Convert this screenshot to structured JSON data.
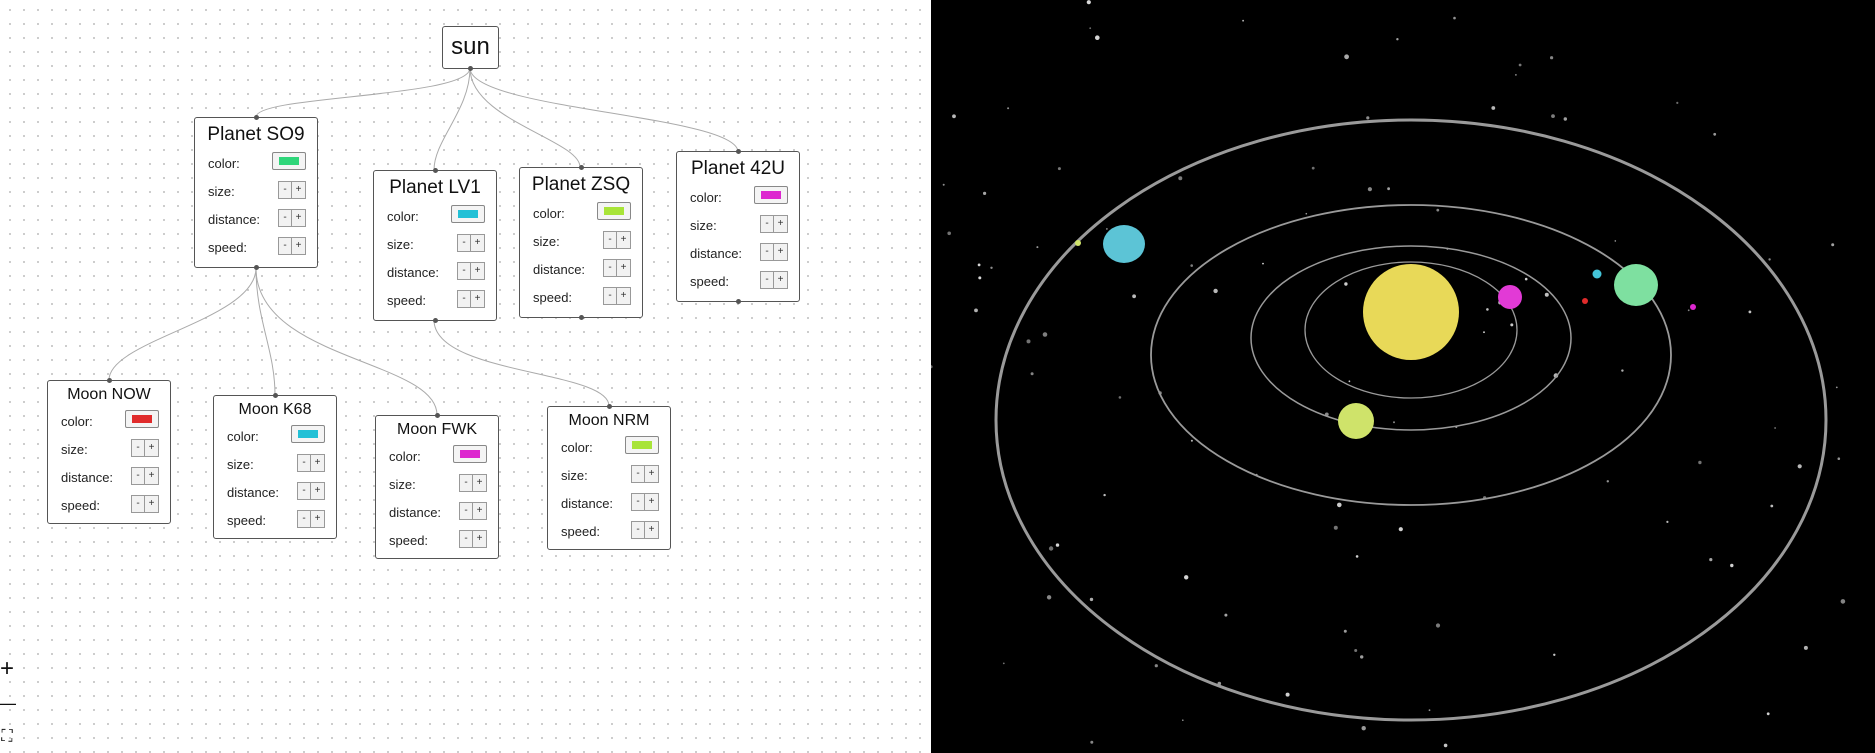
{
  "sun": {
    "label": "sun",
    "color": "#e8d958"
  },
  "planets": [
    {
      "id": "so9",
      "name": "Planet SO9",
      "color": "#2fd67a"
    },
    {
      "id": "lv1",
      "name": "Planet LV1",
      "color": "#22c0d6"
    },
    {
      "id": "zsq",
      "name": "Planet ZSQ",
      "color": "#a8e438"
    },
    {
      "id": "42u",
      "name": "Planet 42U",
      "color": "#dd27cf"
    }
  ],
  "moons": [
    {
      "id": "now",
      "name": "Moon NOW",
      "color": "#e02b2b",
      "parent": "Planet SO9"
    },
    {
      "id": "k68",
      "name": "Moon K68",
      "color": "#22c0d6",
      "parent": "Planet SO9"
    },
    {
      "id": "fwk",
      "name": "Moon FWK",
      "color": "#dd27cf",
      "parent": "Planet SO9"
    },
    {
      "id": "nrm",
      "name": "Moon NRM",
      "color": "#a8e438",
      "parent": "Planet LV1"
    }
  ],
  "labels": {
    "color": "color:",
    "size": "size:",
    "distance": "distance:",
    "speed": "speed:",
    "minus": "-",
    "plus": "+"
  },
  "controls": {
    "zoom_in": "+",
    "zoom_out": "—",
    "fit": "⛶"
  },
  "scene_colors": {
    "background": "#000000",
    "orbit": "#9a9a9a",
    "star": "#d8d8d8",
    "sun": "#e8d958",
    "planet_so9": "#7ee0a0",
    "planet_lv1": "#5cc4d6",
    "planet_zsq": "#cfe36a",
    "planet_42u": "#e23ad6"
  }
}
